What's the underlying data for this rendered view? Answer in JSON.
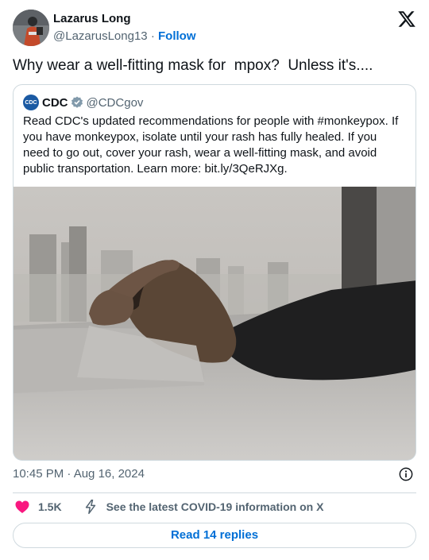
{
  "author": {
    "display_name": "Lazarus Long",
    "handle": "@LazarusLong13",
    "separator": "·",
    "follow_label": "Follow"
  },
  "tweet": {
    "text": "Why wear a well-fitting mask for  mpox?  Unless it's...."
  },
  "quoted": {
    "logo_text": "CDC",
    "name": "CDC",
    "handle": "@CDCgov",
    "verified": true,
    "text": "Read CDC's updated recommendations for people with #monkeypox. If you have monkeypox, isolate until your rash has fully healed. If you need to go out, cover your rash, wear a well-fitting mask, and avoid public transportation. Learn more: bit.ly/3QeRJXg.",
    "image_description_icon": "photo-person-lying-on-bed"
  },
  "meta": {
    "time": "10:45 PM · Aug 16, 2024"
  },
  "actions": {
    "like_count": "1.5K",
    "covid_link": "See the latest COVID-19 information on X"
  },
  "replies": {
    "label": "Read 14 replies"
  },
  "colors": {
    "link_blue": "#006fd6",
    "heart_pink": "#f91880",
    "border": "#cfd9de",
    "muted_text": "#536471"
  }
}
